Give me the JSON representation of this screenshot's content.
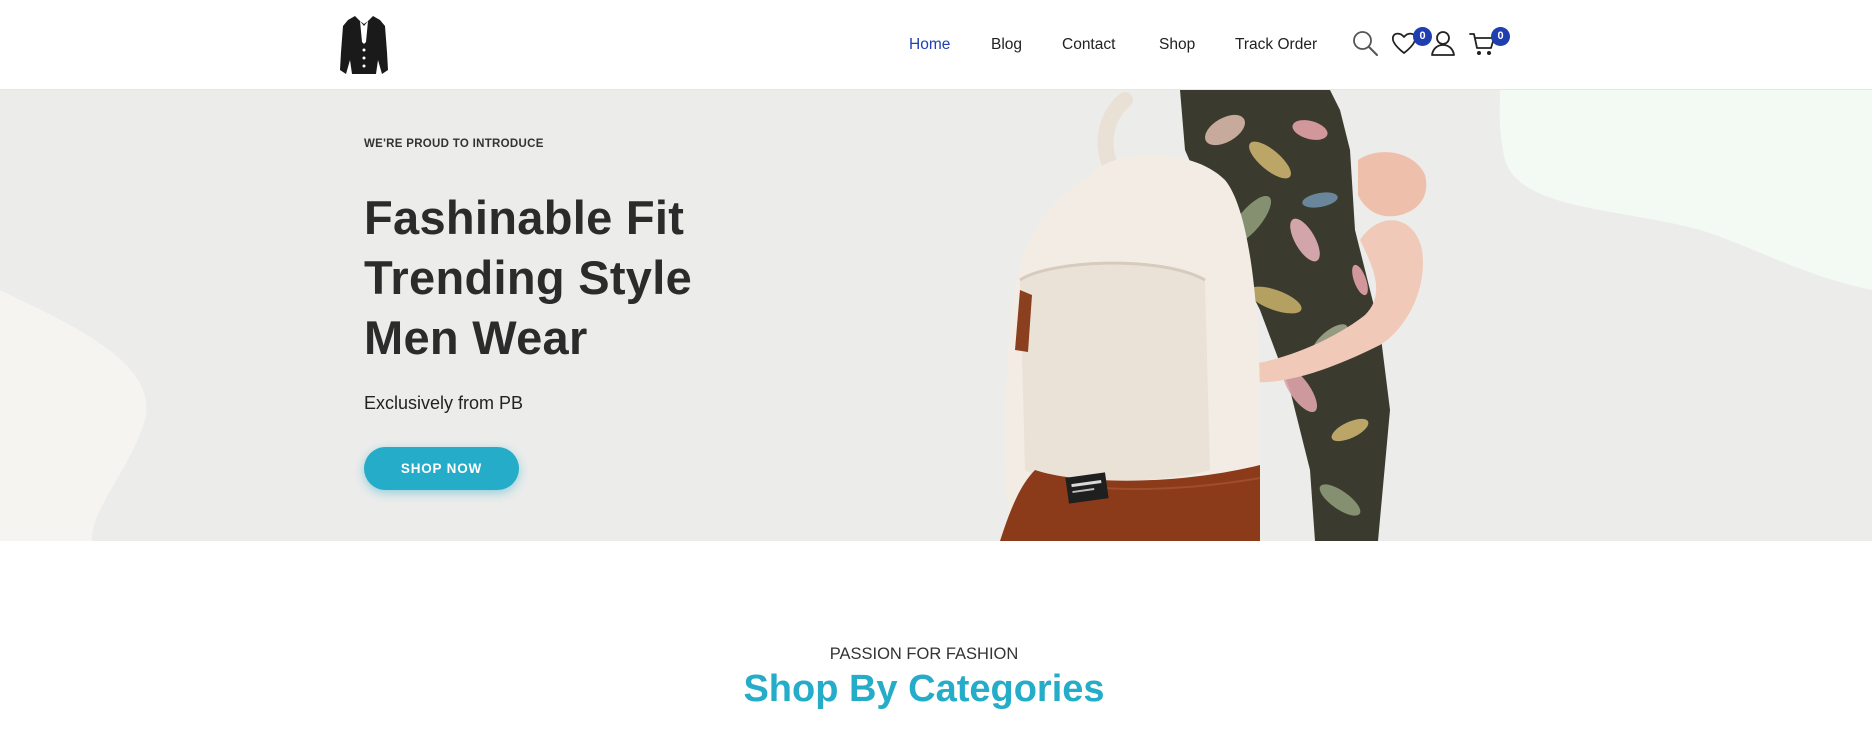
{
  "brand": {
    "logo_icon": "jacket-logo-icon"
  },
  "nav": {
    "items": [
      {
        "label": "Home",
        "active": true
      },
      {
        "label": "Blog",
        "active": false
      },
      {
        "label": "Contact",
        "active": false
      },
      {
        "label": "Shop",
        "active": false
      },
      {
        "label": "Track Order",
        "active": false
      }
    ],
    "icons": {
      "search": "search-icon",
      "wishlist": "heart-icon",
      "account": "user-icon",
      "cart": "cart-icon"
    },
    "wishlist_count": "0",
    "cart_count": "0",
    "active_color": "#1f3fb0",
    "badge_color": "#1f3fb0"
  },
  "hero": {
    "eyebrow": "WE'RE PROUD TO INTRODUCE",
    "headline": [
      "Fashinable Fit",
      "Trending Style",
      "Men Wear"
    ],
    "subline": "Exclusively from PB",
    "cta_label": "SHOP NOW",
    "accent_color": "#24acc9",
    "background_color": "#ececeb"
  },
  "categories": {
    "eyebrow": "PASSION FOR FASHION",
    "title": "Shop By Categories"
  }
}
